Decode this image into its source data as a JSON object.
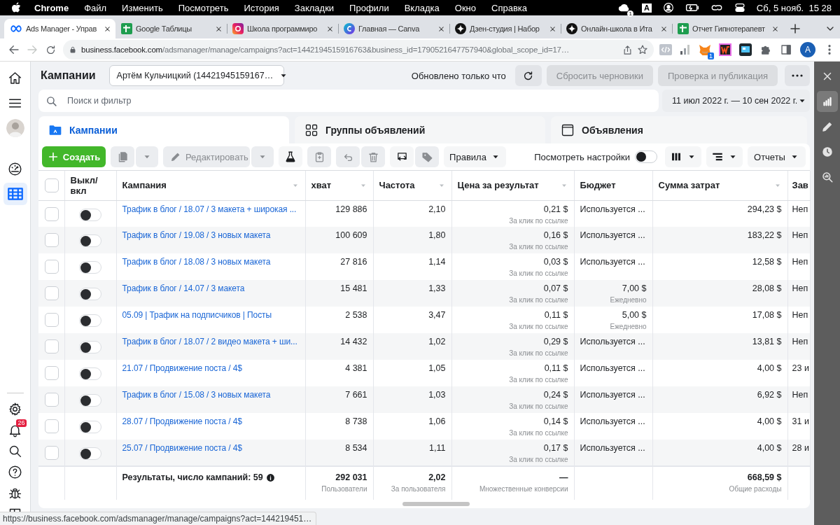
{
  "menubar": {
    "app": "Chrome",
    "items": [
      "Файл",
      "Изменить",
      "Посмотреть",
      "История",
      "Закладки",
      "Профили",
      "Вкладка",
      "Окно",
      "Справка"
    ],
    "cloud_badge": "1",
    "input_source": "A",
    "clock": "Сб, 5 нояб.  15 28"
  },
  "browser_tabs": [
    {
      "title": "Ads Manager - Управ",
      "selected": true
    },
    {
      "title": "Google Таблицы",
      "selected": false
    },
    {
      "title": "Школа программиро",
      "selected": false
    },
    {
      "title": "Главная — Canva",
      "selected": false
    },
    {
      "title": "Дзен-студия | Набор",
      "selected": false
    },
    {
      "title": "Онлайн-школа в Ита",
      "selected": false
    },
    {
      "title": "Отчет Гипнотерапевт",
      "selected": false
    }
  ],
  "address_bar": {
    "host": "business.facebook.com",
    "path": "/adsmanager/manage/campaigns?act=1442194515916763&business_id=1790521647757940&global_scope_id=17…",
    "extension_badge": "1",
    "profile_initial": "A"
  },
  "left_rail": {
    "top": [
      {
        "selected": false
      },
      {
        "selected": false
      },
      {
        "selected": false
      },
      {
        "selected": false
      },
      {
        "selected": true
      }
    ],
    "bottom": [
      {
        "selected": false
      },
      {
        "selected": false,
        "badge": "26"
      },
      {
        "selected": false
      },
      {
        "selected": false
      },
      {
        "selected": false
      },
      {
        "selected": false
      }
    ]
  },
  "header": {
    "title": "Кампании",
    "account": "Артём Кульчицкий (14421945159167…",
    "updated": "Обновлено только что",
    "discard": {
      "label": "Сбросить черновики",
      "disabled": true
    },
    "publish": {
      "label": "Проверка и публикация",
      "disabled": true
    }
  },
  "search": {
    "placeholder": "Поиск и фильтр"
  },
  "date_range": "11 июл 2022 г. — 10 сен 2022 г.",
  "level_tabs": [
    {
      "label": "Кампании",
      "selected": true
    },
    {
      "label": "Группы объявлений",
      "selected": false
    },
    {
      "label": "Объявления",
      "selected": false
    }
  ],
  "toolbar": {
    "create": "Создать",
    "edit": {
      "label": "Редактировать",
      "disabled": true
    },
    "rules": "Правила",
    "view_settings": {
      "label": "Посмотреть настройки",
      "on": false
    },
    "reports": "Отчеты"
  },
  "table": {
    "header_checked": false,
    "columns": [
      {
        "label": "Выкл/ вкл",
        "sortable": false
      },
      {
        "label": "Кампания",
        "sortable": true
      },
      {
        "label": "хват",
        "sortable": true
      },
      {
        "label": "Частота",
        "sortable": true
      },
      {
        "label": "Цена за результат",
        "sortable": true
      },
      {
        "label": "Бюджет",
        "sortable": false
      },
      {
        "label": "Сумма затрат",
        "sortable": true
      },
      {
        "label": "Зав"
      }
    ],
    "rows": [
      {
        "checked": false,
        "on": false,
        "campaign": "Трафик в блог / 18.07 / 3 макета + широкая ...",
        "reach": "129 886",
        "frequency": "2,10",
        "cost": "0,21 $",
        "cost_note": "За клик по ссылке",
        "budget": {
          "kind": "shared",
          "value": "Используется ..."
        },
        "spent": "294,23 $",
        "column_9": "Неп"
      },
      {
        "checked": false,
        "on": false,
        "campaign": "Трафик в блог / 19.08 / 3 новых макета",
        "reach": "100 609",
        "frequency": "1,80",
        "cost": "0,16 $",
        "cost_note": "За клик по ссылке",
        "budget": {
          "kind": "shared",
          "value": "Используется ..."
        },
        "spent": "183,22 $",
        "column_9": "Неп"
      },
      {
        "checked": false,
        "on": false,
        "campaign": "Трафик в блог / 18.08 / 3 новых макета",
        "reach": "27 816",
        "frequency": "1,14",
        "cost": "0,03 $",
        "cost_note": "За клик по ссылке",
        "budget": {
          "kind": "shared",
          "value": "Используется ..."
        },
        "spent": "12,58 $",
        "column_9": "Неп"
      },
      {
        "checked": false,
        "on": false,
        "campaign": "Трафик в блог / 14.07 / 3 макета",
        "reach": "15 481",
        "frequency": "1,33",
        "cost": "0,07 $",
        "cost_note": "За клик по ссылке",
        "budget": {
          "kind": "amount",
          "value": "7,00 $",
          "note": "Ежедневно"
        },
        "spent": "28,08 $",
        "column_9": "Неп"
      },
      {
        "checked": false,
        "on": false,
        "campaign": "05.09 | Трафик на подписчиков | Посты",
        "reach": "2 538",
        "frequency": "3,47",
        "cost": "0,11 $",
        "cost_note": "За клик по ссылке",
        "budget": {
          "kind": "amount",
          "value": "5,00 $",
          "note": "Ежедневно"
        },
        "spent": "17,08 $",
        "column_9": "Неп"
      },
      {
        "checked": false,
        "on": false,
        "campaign": "Трафик в блог / 18.07 / 2 видео макета + ши...",
        "reach": "14 432",
        "frequency": "1,02",
        "cost": "0,29 $",
        "cost_note": "За клик по ссылке",
        "budget": {
          "kind": "shared",
          "value": "Используется ..."
        },
        "spent": "13,81 $",
        "column_9": "Неп"
      },
      {
        "checked": false,
        "on": false,
        "campaign": "21.07 / Продвижение поста / 4$",
        "reach": "4 381",
        "frequency": "1,05",
        "cost": "0,11 $",
        "cost_note": "За клик по ссылке",
        "budget": {
          "kind": "shared",
          "value": "Используется ..."
        },
        "spent": "4,00 $",
        "column_9": "23 и"
      },
      {
        "checked": false,
        "on": false,
        "campaign": "Трафик в блог / 15.08 / 3 новых макета",
        "reach": "7 661",
        "frequency": "1,03",
        "cost": "0,24 $",
        "cost_note": "За клик по ссылке",
        "budget": {
          "kind": "shared",
          "value": "Используется ..."
        },
        "spent": "6,92 $",
        "column_9": "Неп"
      },
      {
        "checked": false,
        "on": false,
        "campaign": "28.07 / Продвижение поста / 4$",
        "reach": "8 738",
        "frequency": "1,06",
        "cost": "0,14 $",
        "cost_note": "За клик по ссылке",
        "budget": {
          "kind": "shared",
          "value": "Используется ..."
        },
        "spent": "4,00 $",
        "column_9": "31 и"
      },
      {
        "checked": false,
        "on": false,
        "campaign": "25.07 / Продвижение поста / 4$",
        "reach": "8 534",
        "frequency": "1,11",
        "cost": "0,17 $",
        "cost_note": "За клик по ссылке",
        "budget": {
          "kind": "shared",
          "value": "Используется ..."
        },
        "spent": "4,00 $",
        "column_9": "28 и"
      }
    ],
    "footer": {
      "label": "Результаты, число кампаний: 59",
      "reach": "292 031",
      "reach_note": "Пользователи",
      "frequency": "2,02",
      "frequency_note": "За пользователя",
      "cost": "—",
      "cost_note": "Множественные конверсии",
      "spent": "668,59 $",
      "spent_note": "Общие расходы"
    }
  },
  "side_panel": [
    {
      "selected": false
    },
    {
      "selected": true
    },
    {
      "selected": false
    },
    {
      "selected": false
    },
    {
      "selected": false
    }
  ],
  "status_url": "https://business.facebook.com/adsmanager/manage/campaigns?act=144219451…"
}
